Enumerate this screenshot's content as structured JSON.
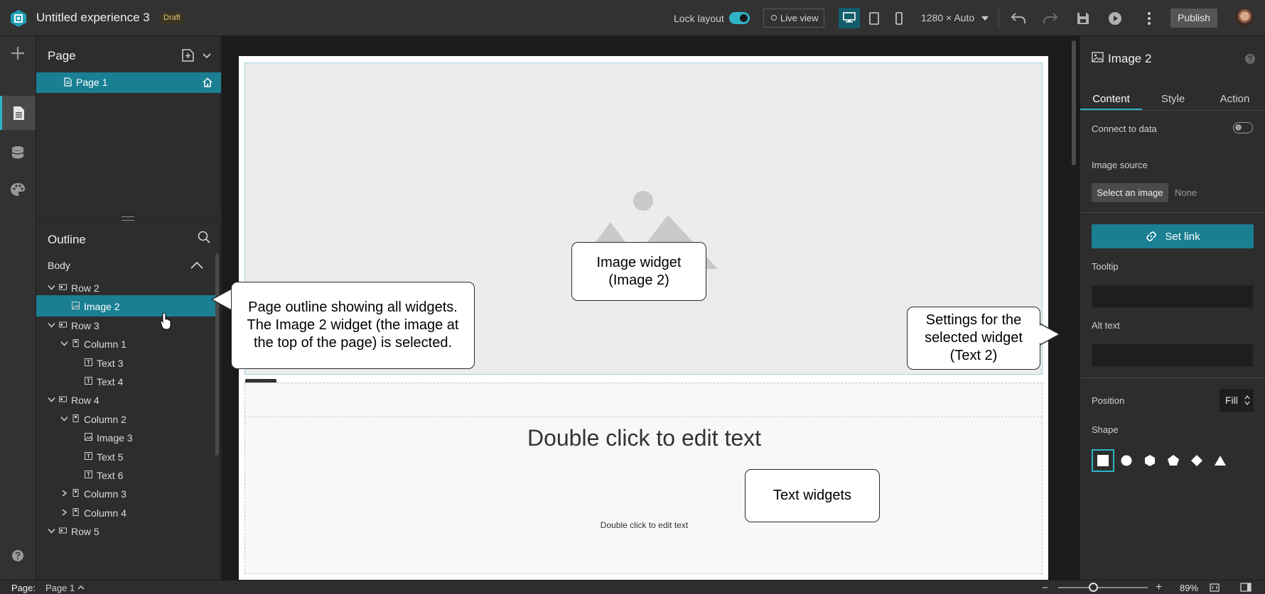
{
  "app": {
    "title": "Untitled experience 3",
    "status_badge": "Draft",
    "lock_layout_label": "Lock layout",
    "lock_layout_on": true,
    "live_view_label": "Live view",
    "resolution": "1280 × Auto",
    "publish_label": "Publish",
    "accent_color": "#2fb4c6"
  },
  "left_rail": {
    "items": [
      "add-widget",
      "page",
      "data",
      "theme"
    ],
    "active": "page",
    "help": "help"
  },
  "page_panel": {
    "title": "Page",
    "pages": [
      {
        "label": "Page 1",
        "is_home": true,
        "selected": true
      }
    ]
  },
  "outline": {
    "title": "Outline",
    "body_label": "Body",
    "items": [
      {
        "label": "Row 2",
        "type": "row",
        "expanded": true
      },
      {
        "label": "Image 2",
        "type": "image",
        "selected": true
      },
      {
        "label": "Row 3",
        "type": "row",
        "expanded": true
      },
      {
        "label": "Column 1",
        "type": "column",
        "expanded": true
      },
      {
        "label": "Text 3",
        "type": "text"
      },
      {
        "label": "Text 4",
        "type": "text"
      },
      {
        "label": "Row 4",
        "type": "row",
        "expanded": true
      },
      {
        "label": "Column 2",
        "type": "column",
        "expanded": true
      },
      {
        "label": "Image 3",
        "type": "image"
      },
      {
        "label": "Text 5",
        "type": "text"
      },
      {
        "label": "Text 6",
        "type": "text"
      },
      {
        "label": "Column 3",
        "type": "column",
        "expanded": false
      },
      {
        "label": "Column 4",
        "type": "column",
        "expanded": false
      },
      {
        "label": "Row 5",
        "type": "row",
        "expanded": true
      }
    ]
  },
  "canvas": {
    "text_large": "Double click to edit text",
    "text_small": "Double click to edit text"
  },
  "callouts": {
    "image_widget": "Image widget\n(Image 2)",
    "outline": "Page outline showing all widgets.\nThe Image 2 widget (the image at\nthe top of the page) is selected.",
    "settings": "Settings for the\nselected widget\n(Text 2)",
    "text_widgets": "Text widgets"
  },
  "settings": {
    "title": "Image 2",
    "tabs": [
      "Content",
      "Style",
      "Action"
    ],
    "active_tab": "Content",
    "connect_to_data_label": "Connect to data",
    "connect_to_data_on": false,
    "image_source_label": "Image source",
    "select_image_label": "Select an image",
    "image_source_value": "None",
    "set_link_label": "Set link",
    "tooltip_label": "Tooltip",
    "tooltip_value": "",
    "alt_text_label": "Alt text",
    "alt_text_value": "",
    "position_label": "Position",
    "position_value": "Fill",
    "shape_label": "Shape",
    "shapes": [
      "square",
      "circle",
      "hexagon",
      "pentagon",
      "diamond",
      "triangle"
    ],
    "active_shape": "square"
  },
  "statusbar": {
    "page_label": "Page:",
    "page_value": "Page 1",
    "zoom_minus": "−",
    "zoom_plus": "+",
    "zoom_value": "89%",
    "zoom_level": 0.89
  }
}
